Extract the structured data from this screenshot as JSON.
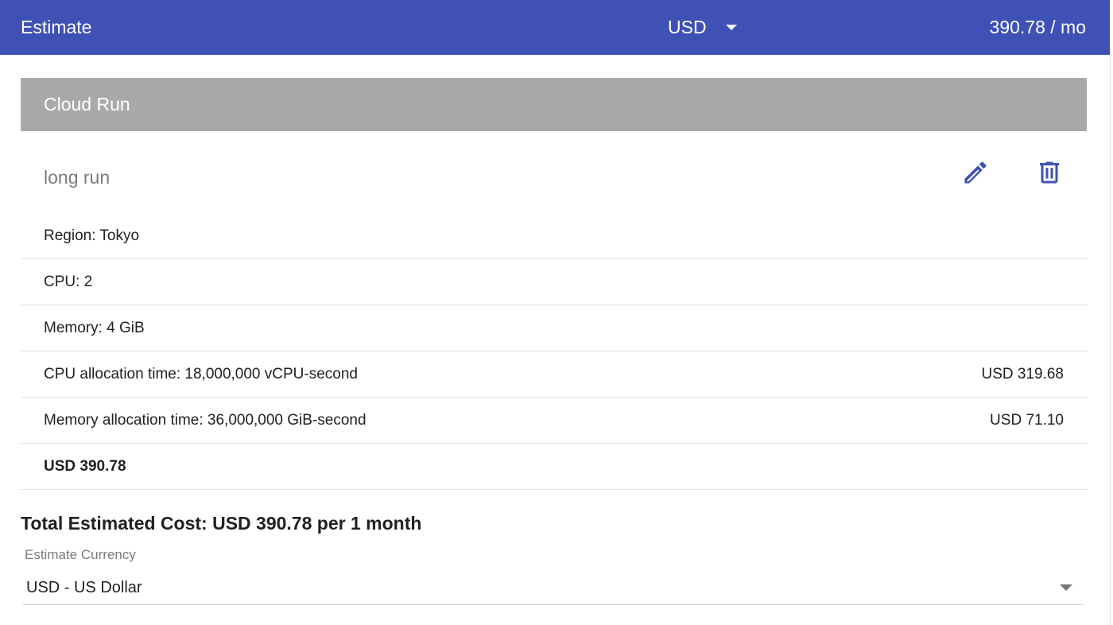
{
  "header": {
    "title": "Estimate",
    "currency": "USD",
    "monthly_total": "390.78 / mo"
  },
  "service": {
    "name": "Cloud Run",
    "item_name": "long run",
    "rows": [
      {
        "label": "Region: Tokyo",
        "value": ""
      },
      {
        "label": "CPU: 2",
        "value": ""
      },
      {
        "label": "Memory: 4 GiB",
        "value": ""
      },
      {
        "label": "CPU allocation time: 18,000,000 vCPU-second",
        "value": "USD 319.68"
      },
      {
        "label": "Memory allocation time: 36,000,000 GiB-second",
        "value": "USD 71.10"
      }
    ],
    "subtotal": "USD 390.78"
  },
  "summary": {
    "total_estimated_cost": "Total Estimated Cost: USD 390.78 per 1 month",
    "currency_label": "Estimate Currency",
    "currency_value": "USD - US Dollar"
  },
  "colors": {
    "header_bg": "#3f51b5",
    "card_header_bg": "#a9a9a9",
    "icon_color": "#3f51b5"
  },
  "icons": [
    "caret-down-icon",
    "pencil-icon",
    "trash-icon"
  ]
}
